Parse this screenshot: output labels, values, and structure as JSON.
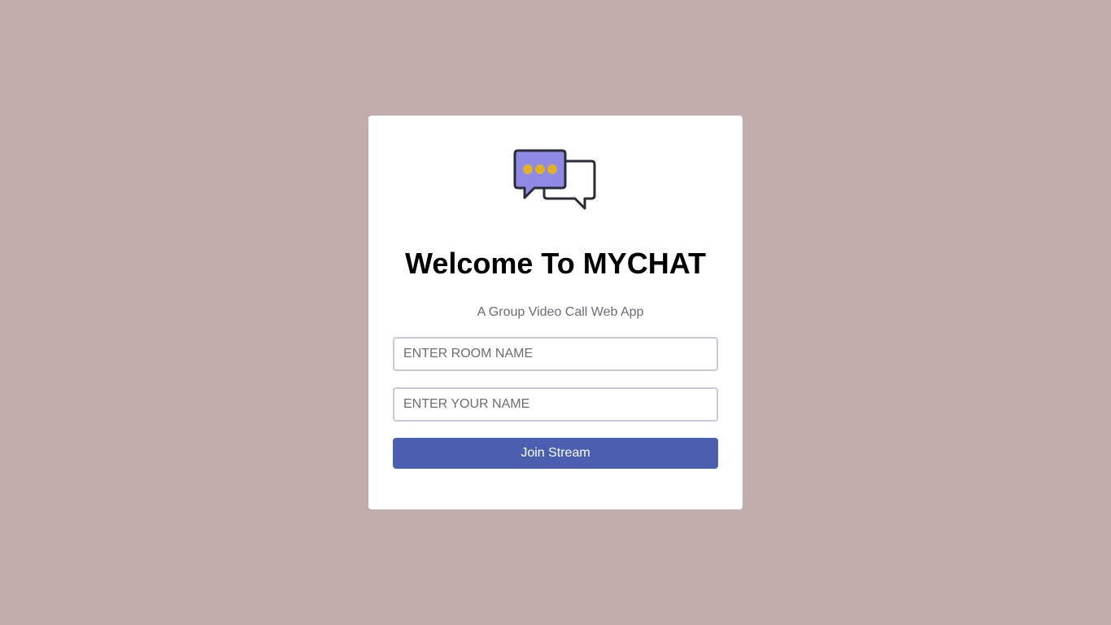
{
  "card": {
    "title": "Welcome To MYCHAT",
    "subtitle": "A Group Video Call Web App",
    "logo_icon": "chat-bubbles-icon"
  },
  "form": {
    "room_placeholder": "ENTER ROOM NAME",
    "room_value": "",
    "name_placeholder": "ENTER YOUR NAME",
    "name_value": "",
    "join_label": "Join Stream"
  },
  "colors": {
    "background": "#c1aeac",
    "card": "#ffffff",
    "button": "#4b5fb0",
    "bubble_front": "#8f8ae6",
    "bubble_dots": "#e0b22a",
    "outline": "#2b2b3a"
  }
}
